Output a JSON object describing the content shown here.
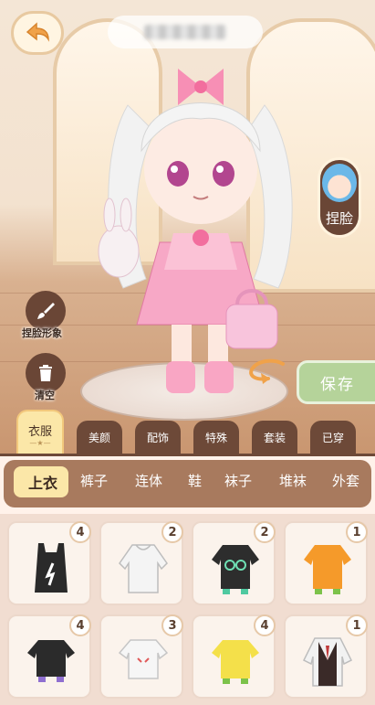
{
  "header": {
    "name_placeholder": ""
  },
  "face_button": {
    "label": "捏脸"
  },
  "side_tools": {
    "pinch_face": "捏脸形象",
    "clear": "清空"
  },
  "save_button": {
    "label": "保存"
  },
  "category_tabs": [
    {
      "label": "衣服",
      "active": true
    },
    {
      "label": "美颜"
    },
    {
      "label": "配饰"
    },
    {
      "label": "特殊"
    },
    {
      "label": "套装"
    },
    {
      "label": "已穿"
    }
  ],
  "sub_tabs": [
    "上衣",
    "裤子",
    "连体",
    "鞋",
    "袜子",
    "堆袜",
    "外套"
  ],
  "items": [
    {
      "count": "4",
      "icon": "black-tank-top-icon",
      "color": "#2a2a2a"
    },
    {
      "count": "2",
      "icon": "white-hoodie-icon",
      "color": "#f4f4f4"
    },
    {
      "count": "2",
      "icon": "black-tshirt-icon",
      "color": "#2d2d2d"
    },
    {
      "count": "1",
      "icon": "orange-tshirt-icon",
      "color": "#f59a2a"
    },
    {
      "count": "4",
      "icon": "black-crop-top-icon",
      "color": "#2b2b2b"
    },
    {
      "count": "3",
      "icon": "white-tshirt-icon",
      "color": "#f6f6f6"
    },
    {
      "count": "4",
      "icon": "yellow-tshirt-icon",
      "color": "#f4e04a"
    },
    {
      "count": "1",
      "icon": "school-uniform-icon",
      "color": "#3a2a28"
    }
  ]
}
